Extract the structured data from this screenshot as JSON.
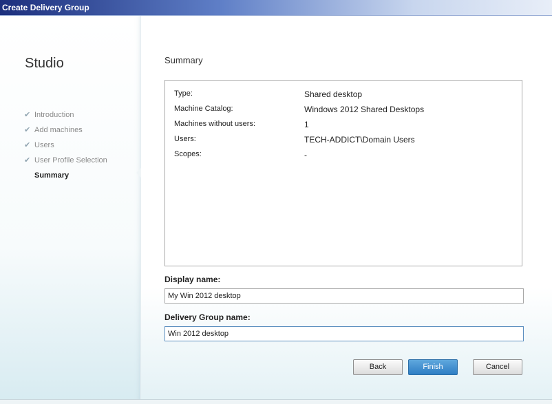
{
  "window": {
    "title": "Create Delivery Group"
  },
  "sidebar": {
    "brand": "Studio",
    "steps": [
      {
        "label": "Introduction",
        "done": true
      },
      {
        "label": "Add machines",
        "done": true
      },
      {
        "label": "Users",
        "done": true
      },
      {
        "label": "User Profile Selection",
        "done": true
      },
      {
        "label": "Summary",
        "active": true
      }
    ]
  },
  "main": {
    "heading": "Summary",
    "summary": [
      {
        "label": "Type:",
        "value": "Shared desktop"
      },
      {
        "label": "Machine Catalog:",
        "value": "Windows 2012 Shared Desktops"
      },
      {
        "label": "Machines without users:",
        "value": "1"
      },
      {
        "label": "Users:",
        "value": "TECH-ADDICT\\Domain Users"
      },
      {
        "label": "Scopes:",
        "value": "-"
      }
    ],
    "display_name": {
      "label": "Display name:",
      "value": "My Win 2012 desktop"
    },
    "group_name": {
      "label": "Delivery Group name:",
      "value": "Win 2012 desktop"
    }
  },
  "buttons": {
    "back": "Back",
    "finish": "Finish",
    "cancel": "Cancel"
  },
  "colors": {
    "titlebar_start": "#1c2f7d",
    "finish_button": "#2f7ec4"
  }
}
